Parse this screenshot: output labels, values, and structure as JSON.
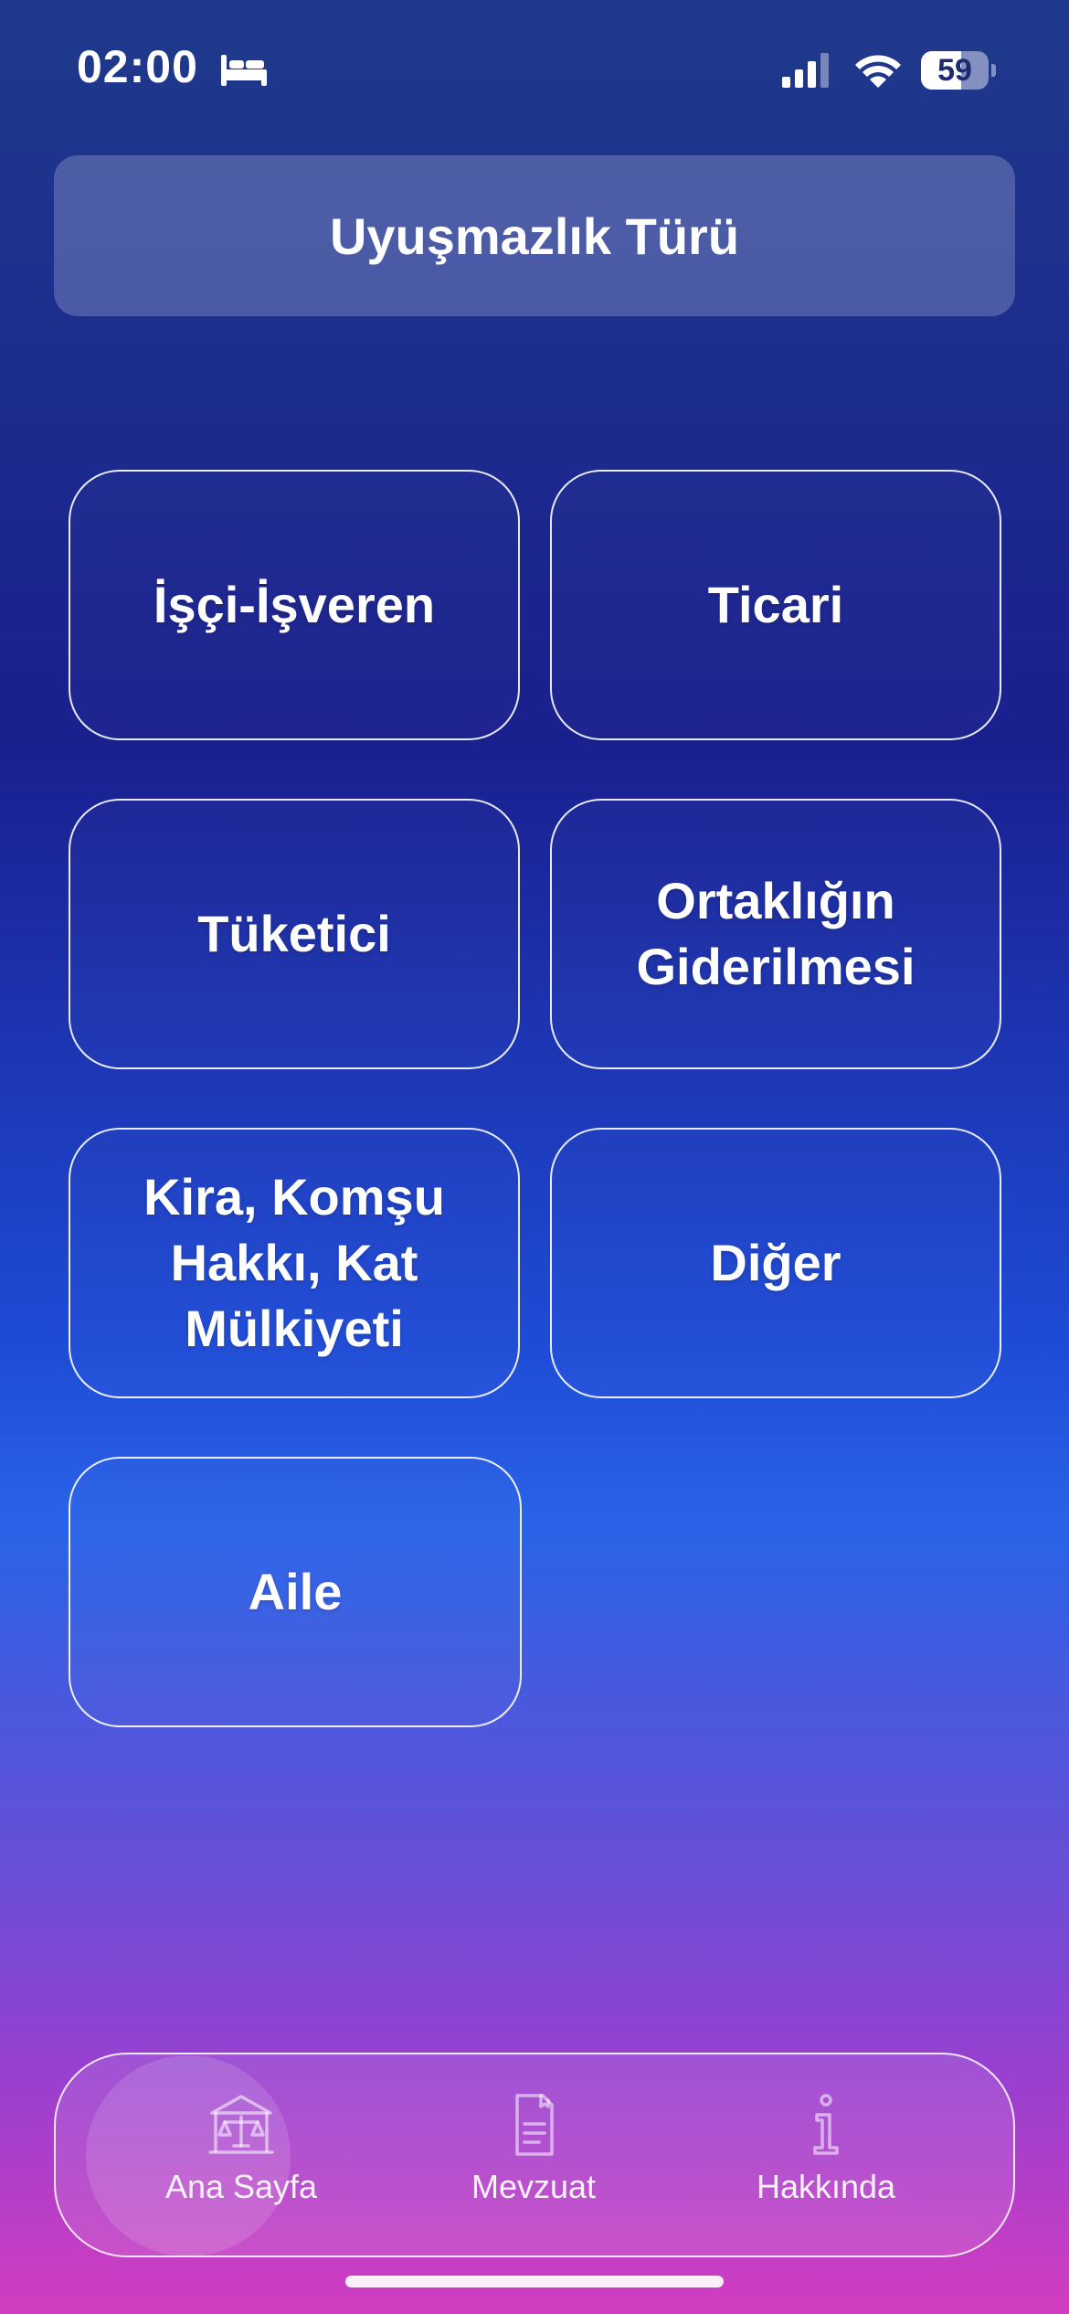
{
  "status_bar": {
    "time": "02:00",
    "battery": "59",
    "battery_level": 0.59,
    "icons": [
      "bed-icon",
      "cellular-signal-icon",
      "wifi-icon",
      "battery-icon"
    ]
  },
  "header": {
    "title": "Uyuşmazlık Türü"
  },
  "categories": [
    "İşçi-İşveren",
    "Ticari",
    "Tüketici",
    "Ortaklığın Giderilmesi",
    "Kira, Komşu Hakkı, Kat Mülkiyeti",
    "Diğer",
    "Aile"
  ],
  "tab_bar": {
    "items": [
      {
        "label": "Ana Sayfa",
        "icon": "courthouse-scales-icon",
        "selected": true
      },
      {
        "label": "Mevzuat",
        "icon": "document-icon",
        "selected": false
      },
      {
        "label": "Hakkında",
        "icon": "info-icon",
        "selected": false
      }
    ]
  }
}
